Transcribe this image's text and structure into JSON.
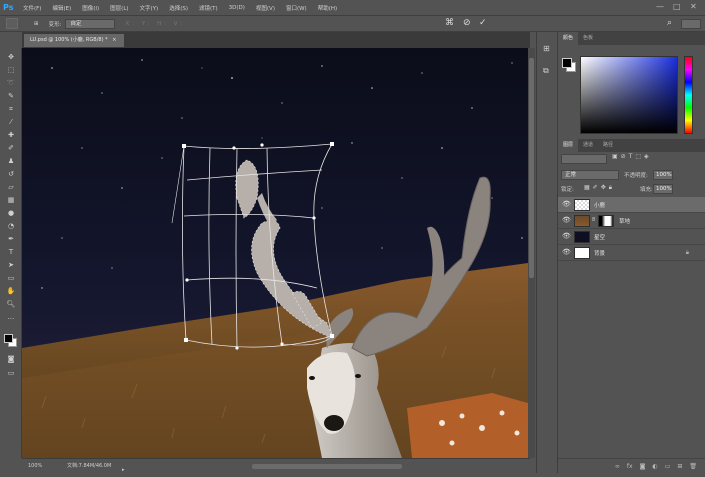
{
  "app": {
    "logo": "Ps"
  },
  "menu": [
    "文件(F)",
    "编辑(E)",
    "图像(I)",
    "图层(L)",
    "文字(Y)",
    "选择(S)",
    "滤镜(T)",
    "3D(D)",
    "视图(V)",
    "窗口(W)",
    "帮助(H)"
  ],
  "window_controls": {
    "minimize": "—",
    "maximize": "□",
    "close": "✕"
  },
  "options": {
    "warp_label": "变形:",
    "warp_value": "自定",
    "dim_fields": "X: Y: H: V:",
    "cancel_glyph": "⊘",
    "commit_glyph": "✓"
  },
  "document": {
    "tab": "LU.psd @ 100% (小鹿, RGB/8) *",
    "tab_close": "×",
    "zoom": "100%",
    "doc_size": "文档:7.84M/46.0M"
  },
  "color_panel": {
    "tabs": [
      "颜色",
      "色板"
    ]
  },
  "layers_panel": {
    "tabs": [
      "图层",
      "通道",
      "路径"
    ],
    "blend_mode": "正常",
    "opacity_label": "不透明度:",
    "opacity": "100%",
    "lock_label": "锁定:",
    "fill_label": "填充:",
    "fill": "100%",
    "layers": [
      {
        "name": "小鹿",
        "selected": true,
        "thumb": "antler"
      },
      {
        "name": "草地",
        "selected": false,
        "thumb": "grass",
        "has_mask": true
      },
      {
        "name": "星空",
        "selected": false,
        "thumb": "sky"
      },
      {
        "name": "背景",
        "selected": false,
        "thumb": "white",
        "locked": true
      }
    ]
  },
  "colors": {
    "panel_bg": "#535353",
    "accent_ps": "#31a8ff",
    "sky": "#0d0f1e",
    "grass": "#8b5a2b"
  }
}
